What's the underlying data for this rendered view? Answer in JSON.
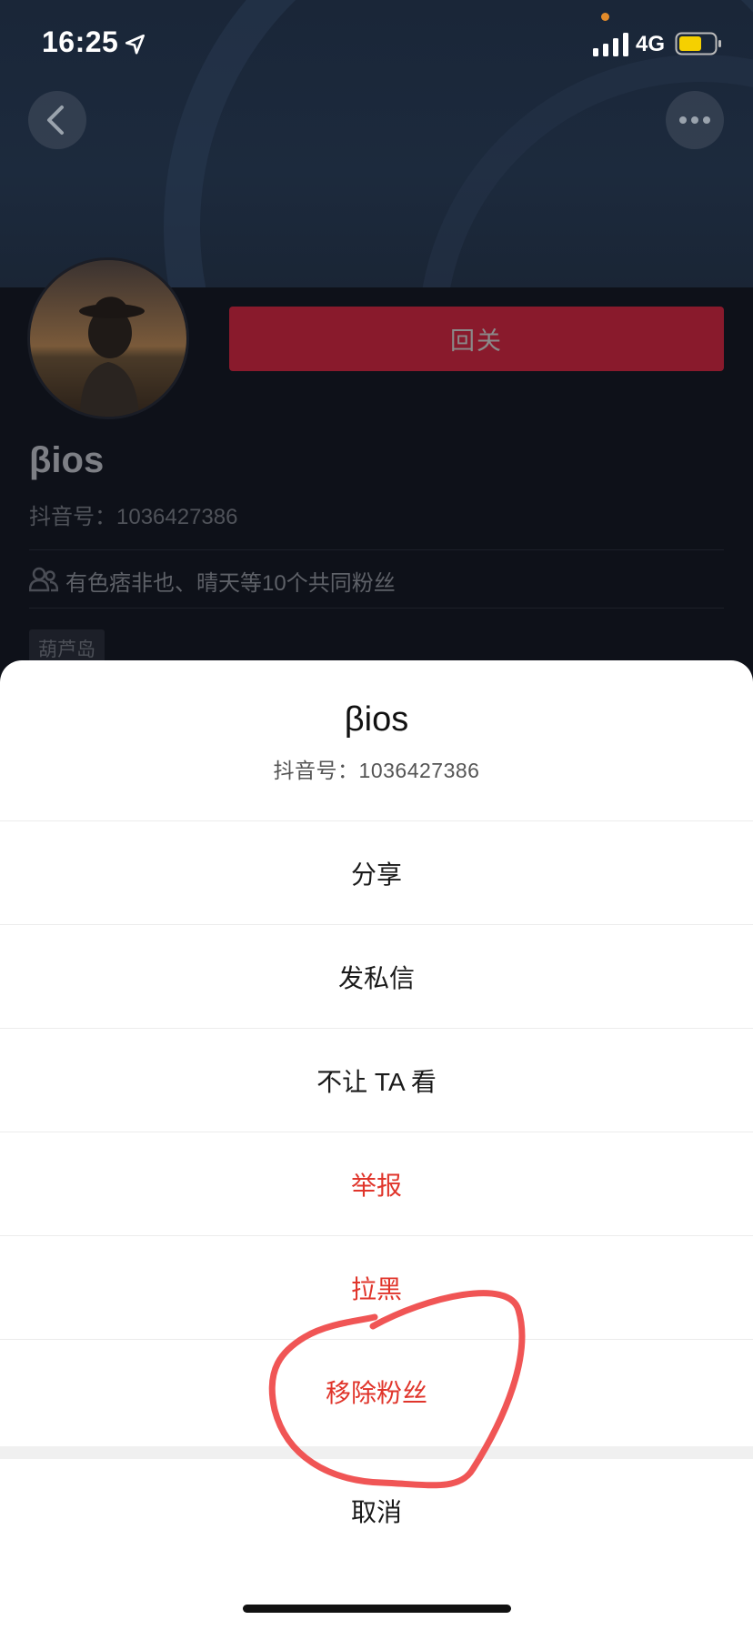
{
  "status_bar": {
    "time": "16:25",
    "network": "4G",
    "battery_color": "#f5d000",
    "icons": [
      "location-arrow-icon",
      "signal-bars-icon",
      "battery-icon"
    ]
  },
  "header": {
    "back_icon": "chevron-left-icon",
    "more_icon": "ellipsis-icon"
  },
  "profile": {
    "name": "βios",
    "douyin_id": "抖音号：1036427386",
    "follow_back_label": "回关",
    "mutual_followers": "有色痞非也、晴天等10个共同粉丝",
    "location_tag": "葫芦岛"
  },
  "sheet": {
    "title": "βios",
    "subtitle": "抖音号：1036427386",
    "items": [
      {
        "label": "分享",
        "style": "normal"
      },
      {
        "label": "发私信",
        "style": "normal"
      },
      {
        "label": "不让 TA 看",
        "style": "normal"
      },
      {
        "label": "举报",
        "style": "danger"
      },
      {
        "label": "拉黑",
        "style": "danger"
      },
      {
        "label": "移除粉丝",
        "style": "danger"
      }
    ],
    "cancel_label": "取消"
  },
  "colors": {
    "danger": "#e0352b",
    "follow_button": "#891a2c",
    "annotation": "#f05555"
  }
}
